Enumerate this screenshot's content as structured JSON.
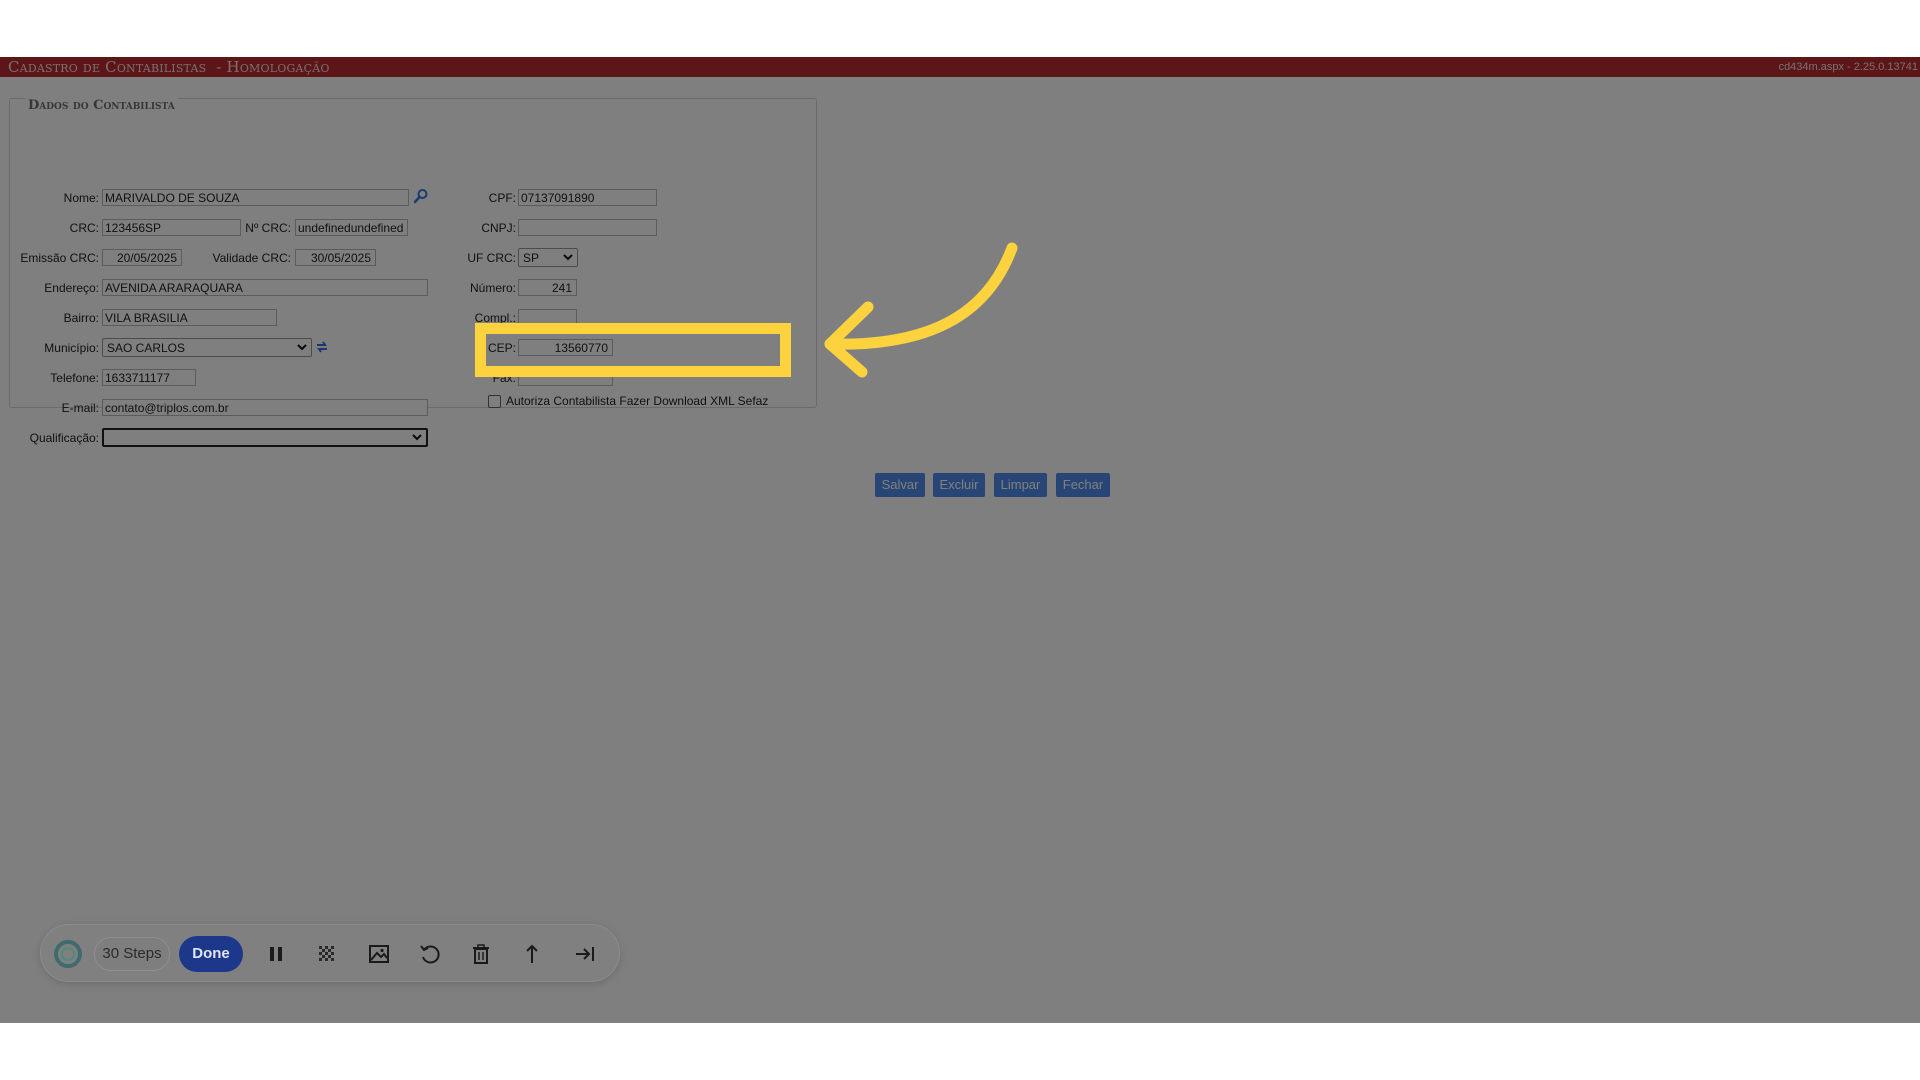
{
  "window": {
    "title": "Cadastro de Contabilistas  - Homologação",
    "version": "cd434m.aspx - 2.25.0.13741"
  },
  "form": {
    "legend": "Dados do Contabilista",
    "nome": {
      "label": "Nome:",
      "value": "MARIVALDO DE SOUZA"
    },
    "cpf": {
      "label": "CPF:",
      "value": "07137091890"
    },
    "crc": {
      "label": "CRC:",
      "value": "123456SP"
    },
    "num_crc": {
      "label": "Nº CRC:",
      "value": "undefinedundefined"
    },
    "cnpj": {
      "label": "CNPJ:",
      "value": ""
    },
    "emissao_crc": {
      "label": "Emissão CRC:",
      "value": "20/05/2025"
    },
    "validade_crc": {
      "label": "Validade CRC:",
      "value": "30/05/2025"
    },
    "uf_crc": {
      "label": "UF CRC:",
      "value": "SP"
    },
    "endereco": {
      "label": "Endereço:",
      "value": "AVENIDA ARARAQUARA"
    },
    "numero": {
      "label": "Número:",
      "value": "241"
    },
    "bairro": {
      "label": "Bairro:",
      "value": "VILA BRASILIA"
    },
    "compl": {
      "label": "Compl.:",
      "value": ""
    },
    "municipio": {
      "label": "Município:",
      "value": "SAO CARLOS"
    },
    "cep": {
      "label": "CEP:",
      "value": "13560770"
    },
    "telefone": {
      "label": "Telefone:",
      "value": "1633711177"
    },
    "fax": {
      "label": "Fax:",
      "value": ""
    },
    "email": {
      "label": "E-mail:",
      "value": "contato@triplos.com.br"
    },
    "qualificacao": {
      "label": "Qualificação:",
      "value": ""
    },
    "autoriza_xml": {
      "label": "Autoriza Contabilista Fazer Download XML Sefaz",
      "checked": false
    }
  },
  "buttons": {
    "salvar": "Salvar",
    "excluir": "Excluir",
    "limpar": "Limpar",
    "fechar": "Fechar"
  },
  "annotation": {
    "highlight_color": "#fcd33e"
  },
  "recorder_toolbar": {
    "steps_label": "30 Steps",
    "done_label": "Done",
    "icons": [
      "pause-icon",
      "blur-icon",
      "image-icon",
      "undo-icon",
      "delete-icon",
      "export-icon",
      "skip-icon"
    ]
  },
  "colors": {
    "title_bar": "#b92d30",
    "button": "#4e8ded",
    "done_button": "#1d388b"
  }
}
